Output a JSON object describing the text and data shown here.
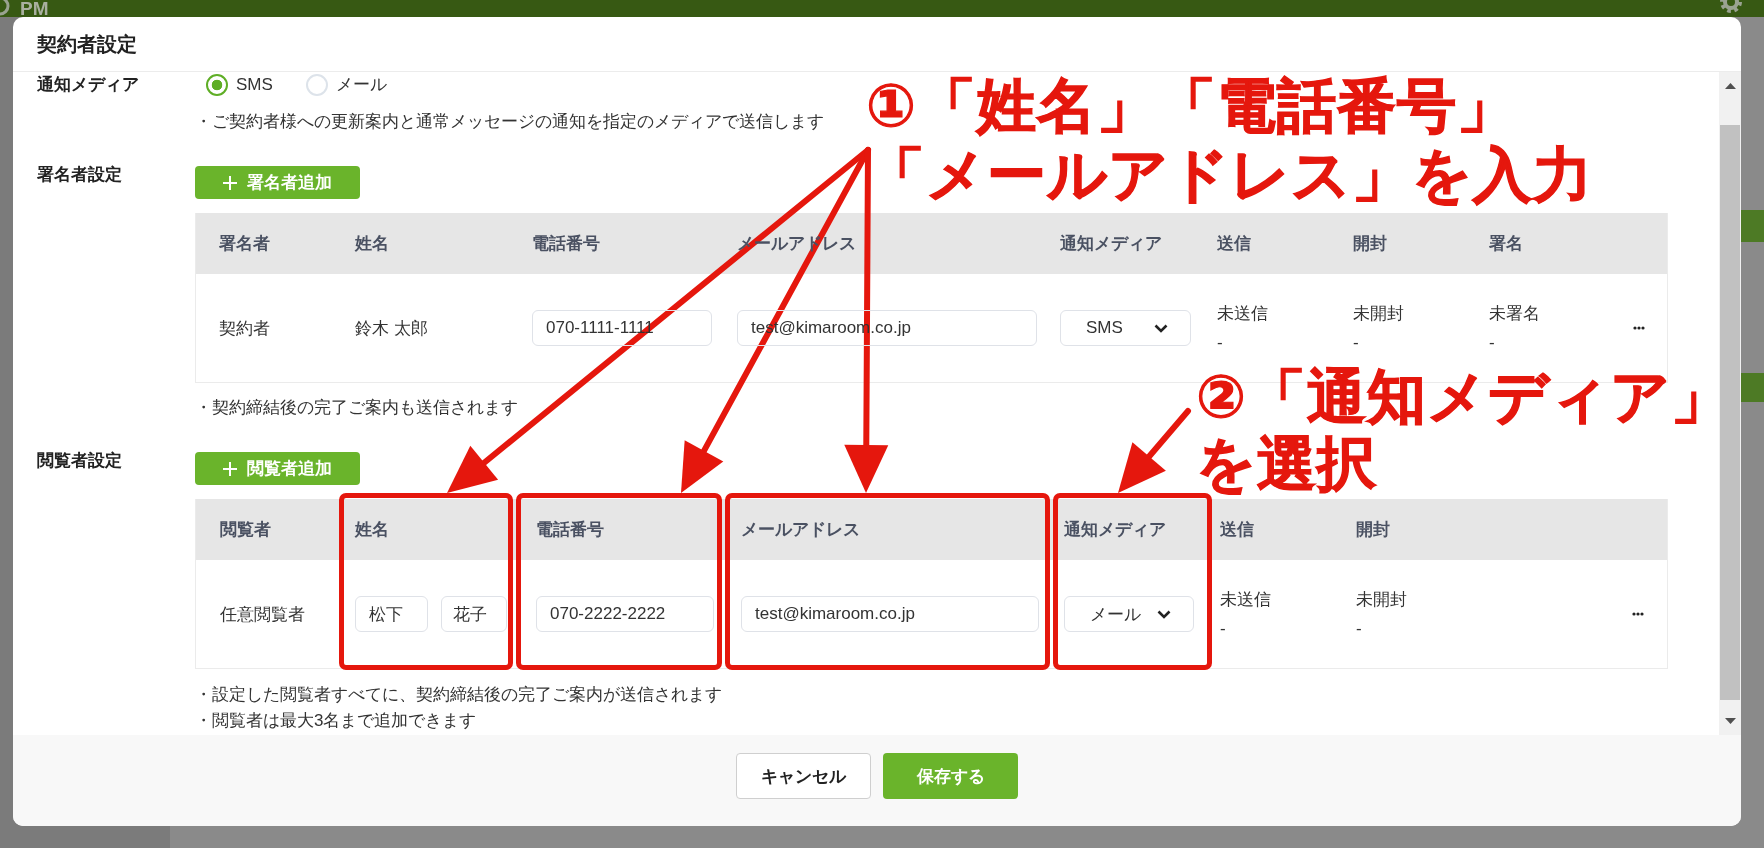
{
  "page": {
    "logo": "PM"
  },
  "dialog": {
    "title": "契約者設定"
  },
  "notification": {
    "label": "通知メディア",
    "options": [
      {
        "label": "SMS",
        "selected": true
      },
      {
        "label": "メール",
        "selected": false
      }
    ],
    "note": "・ご契約者様への更新案内と通常メッセージの通知を指定のメディアで送信します"
  },
  "signers": {
    "label": "署名者設定",
    "add_button": "署名者追加",
    "columns": [
      "署名者",
      "姓名",
      "電話番号",
      "メールアドレス",
      "通知メディア",
      "送信",
      "開封",
      "署名"
    ],
    "rows": [
      {
        "role": "契約者",
        "name": "鈴木 太郎",
        "phone": "070-1111-1111",
        "email": "test@kimaroom.co.jp",
        "media": "SMS",
        "sent": {
          "status": "未送信",
          "detail": "-"
        },
        "opened": {
          "status": "未開封",
          "detail": "-"
        },
        "signed": {
          "status": "未署名",
          "detail": "-"
        }
      }
    ],
    "notes": [
      "・契約締結後の完了ご案内も送信されます"
    ]
  },
  "viewers": {
    "label": "閲覧者設定",
    "add_button": "閲覧者追加",
    "columns": [
      {
        "label": "閲覧者",
        "highlighted": false
      },
      {
        "label": "姓名",
        "highlighted": true
      },
      {
        "label": "電話番号",
        "highlighted": true
      },
      {
        "label": "メールアドレス",
        "highlighted": true
      },
      {
        "label": "通知メディア",
        "highlighted": true
      },
      {
        "label": "送信",
        "highlighted": false
      },
      {
        "label": "開封",
        "highlighted": false
      }
    ],
    "rows": [
      {
        "role": "任意閲覧者",
        "name_fields": [
          "松下",
          "花子"
        ],
        "phone": "070-2222-2222",
        "email": "test@kimaroom.co.jp",
        "media": "メール",
        "sent": {
          "status": "未送信",
          "detail": "-"
        },
        "opened": {
          "status": "未開封",
          "detail": "-"
        }
      }
    ],
    "notes": [
      "・設定した閲覧者すべてに、契約締結後の完了ご案内が送信されます",
      "・閲覧者は最大3名まで追加できます"
    ]
  },
  "footer": {
    "buttons": [
      {
        "label": "キャンセル",
        "kind": "secondary"
      },
      {
        "label": "保存する",
        "kind": "primary"
      }
    ]
  },
  "annotations": [
    {
      "lines": [
        "①「姓名」「電話番号」",
        "「メールアドレス」を入力"
      ]
    },
    {
      "lines": [
        "②「通知メディア」",
        "を選択"
      ]
    }
  ]
}
